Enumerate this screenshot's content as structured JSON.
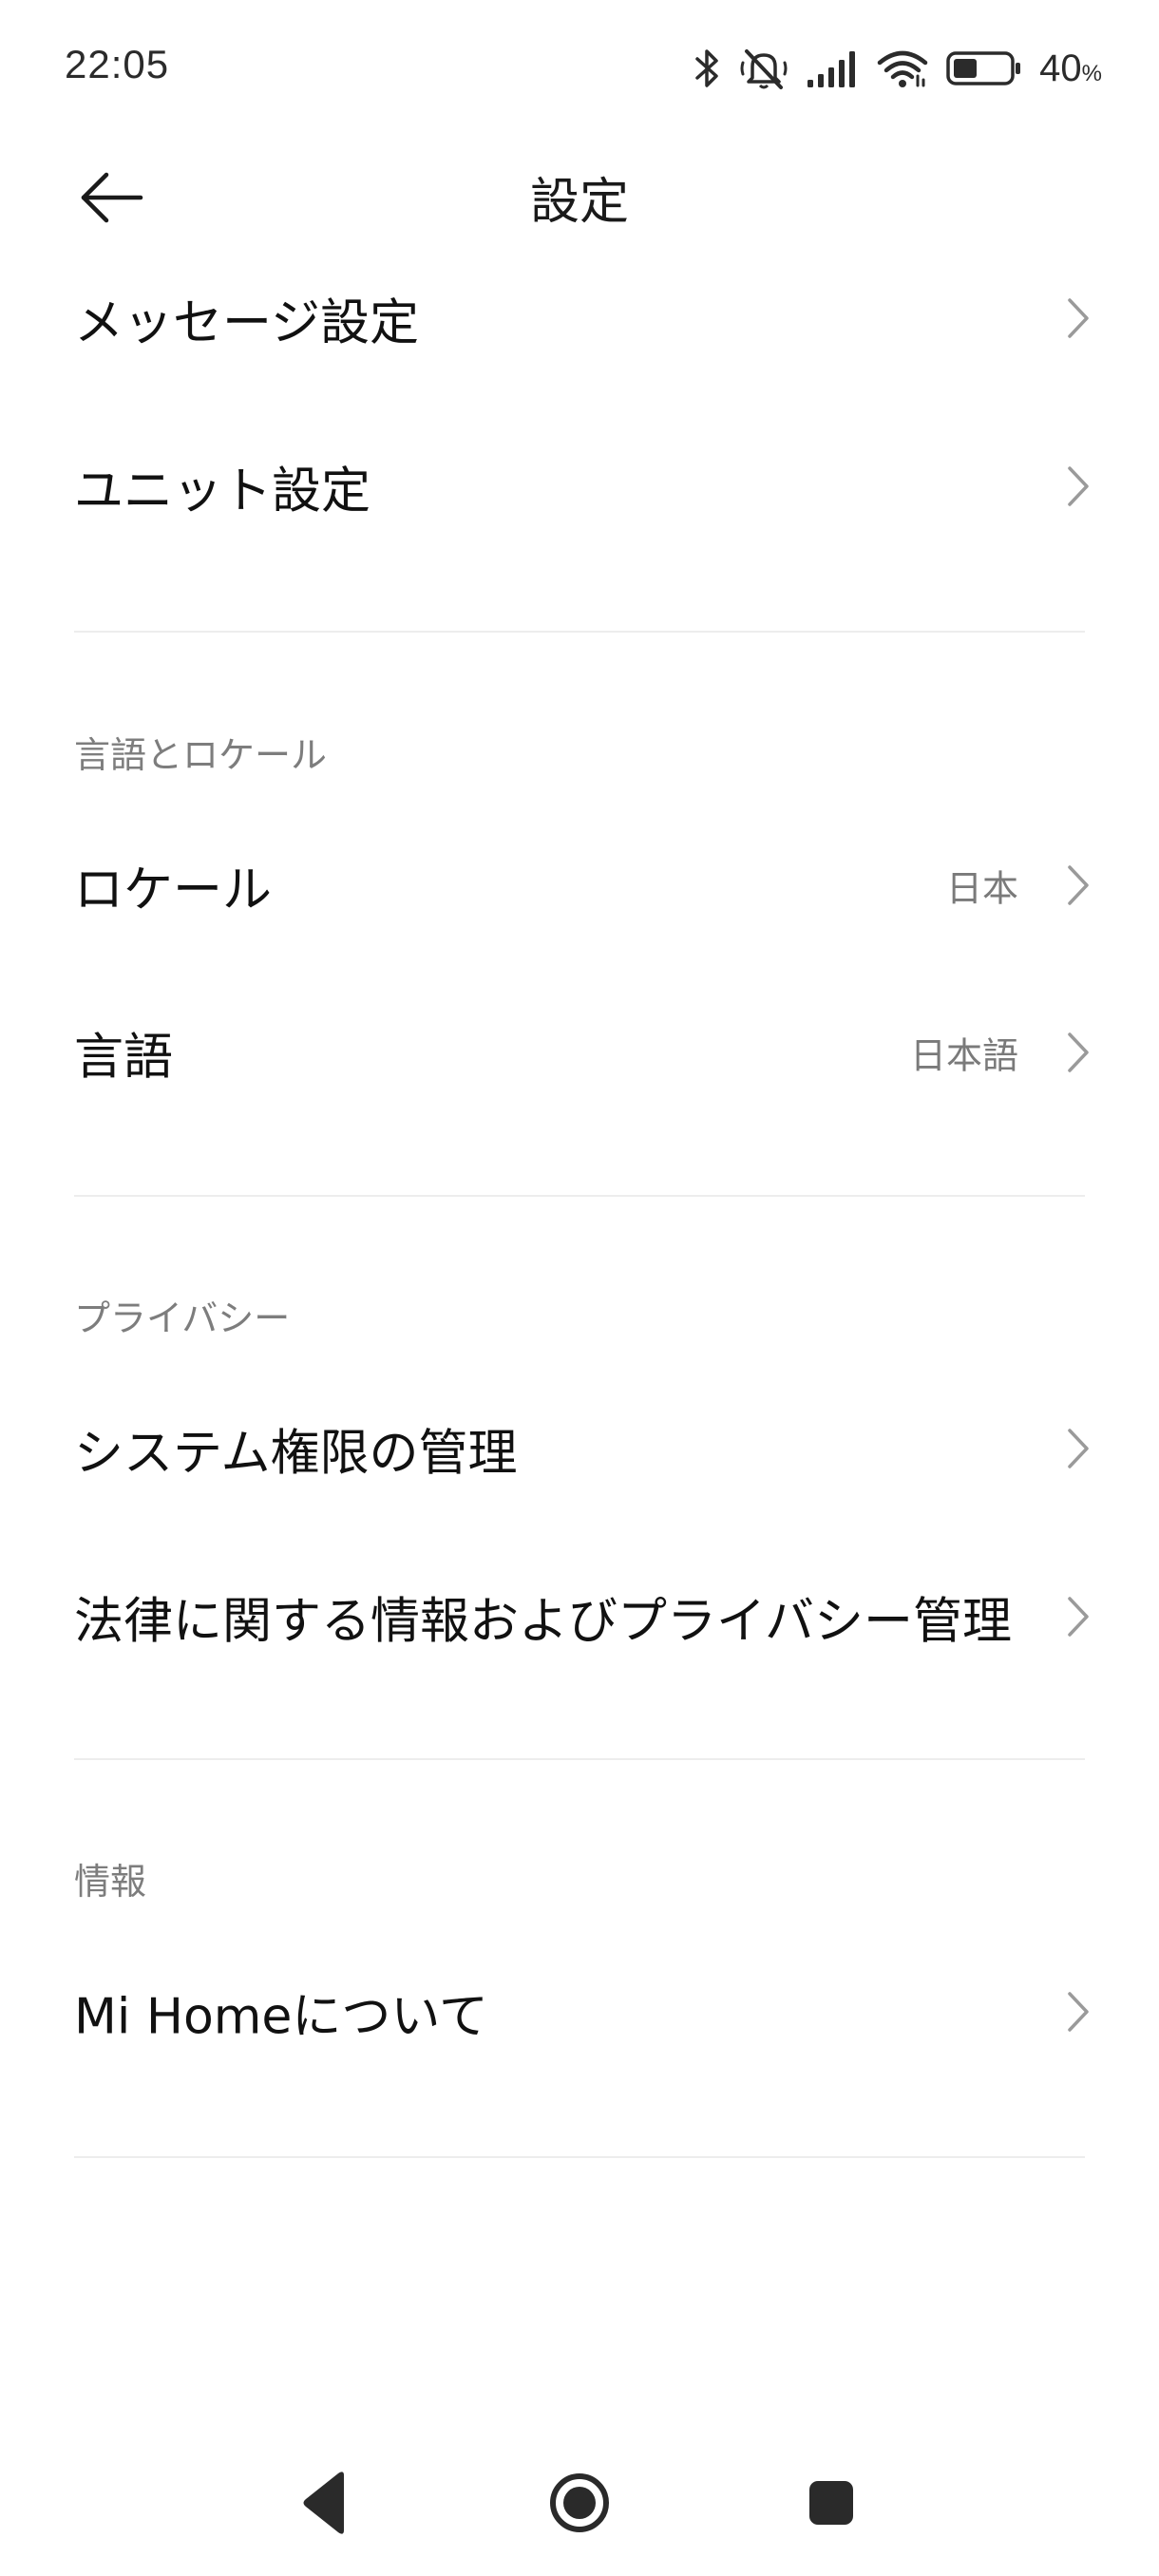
{
  "status_bar": {
    "time": "22:05",
    "battery_percent": "40",
    "battery_unit": "%",
    "icons": [
      "bluetooth-icon",
      "mute-icon",
      "signal-icon",
      "wifi-icon",
      "battery-icon"
    ]
  },
  "header": {
    "title": "設定",
    "back_icon": "arrow-left-icon"
  },
  "items": {
    "message_settings": "メッセージ設定",
    "unit_settings": "ユニット設定"
  },
  "language_section": {
    "title": "言語とロケール",
    "locale_label": "ロケール",
    "locale_value": "日本",
    "language_label": "言語",
    "language_value": "日本語"
  },
  "privacy_section": {
    "title": "プライバシー",
    "system_permissions": "システム権限の管理",
    "legal_privacy": "法律に関する情報およびプライバシー管理"
  },
  "info_section": {
    "title": "情報",
    "about": "Mi Homeについて"
  },
  "nav_bar": {
    "icons": [
      "back-triangle-icon",
      "home-circle-icon",
      "recents-square-icon"
    ]
  }
}
